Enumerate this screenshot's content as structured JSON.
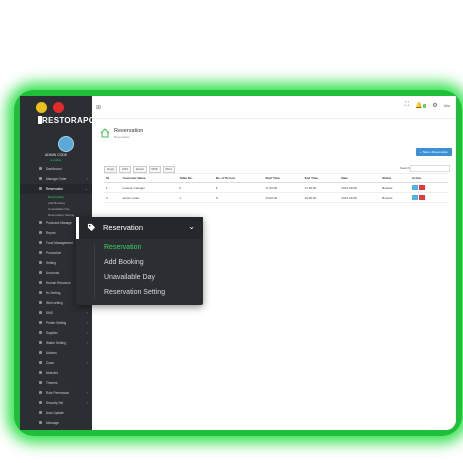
{
  "window": {
    "traffic_lights": [
      "#e8c21a",
      "#e42a2a",
      "#2bb642"
    ],
    "glow_color": "#1fbf3a"
  },
  "brand": {
    "name": "RESTORAPOS"
  },
  "user": {
    "name": "ADMIN CODE",
    "status": "● online"
  },
  "sidebar": {
    "items": [
      {
        "label": "Dashboard",
        "icon": "dashboard-icon"
      },
      {
        "label": "Manage Order",
        "icon": "cart-icon",
        "chevron": "›"
      },
      {
        "label": "Reservation",
        "icon": "tag-icon",
        "chevron": "⌄",
        "active": true
      },
      {
        "label": "Purchase Manage",
        "icon": "box-icon",
        "chevron": "›"
      },
      {
        "label": "Report",
        "icon": "chart-icon",
        "chevron": "›"
      },
      {
        "label": "Food Management",
        "icon": "food-icon",
        "chevron": "›"
      },
      {
        "label": "Production",
        "icon": "factory-icon",
        "chevron": "›"
      },
      {
        "label": "Setting",
        "icon": "gear-icon",
        "chevron": "›"
      },
      {
        "label": "Accounts",
        "icon": "wallet-icon",
        "chevron": "›"
      },
      {
        "label": "Human Resource",
        "icon": "people-icon",
        "chevron": "›"
      },
      {
        "label": "Hr-Setting",
        "icon": "sliders-icon",
        "chevron": "›"
      },
      {
        "label": "Web setting",
        "icon": "globe-icon",
        "chevron": "›"
      },
      {
        "label": "SMS",
        "icon": "sms-icon",
        "chevron": "›"
      },
      {
        "label": "Printer Setting",
        "icon": "printer-icon",
        "chevron": "›"
      },
      {
        "label": "Supplier",
        "icon": "truck-icon",
        "chevron": "›"
      },
      {
        "label": "Waiter Setting",
        "icon": "waiter-icon",
        "chevron": "›"
      },
      {
        "label": "Addons",
        "icon": "addons-icon"
      },
      {
        "label": "Zoom",
        "icon": "zoom-icon",
        "chevron": "›"
      },
      {
        "label": "Modules",
        "icon": "modules-icon"
      },
      {
        "label": "Themes",
        "icon": "themes-icon"
      },
      {
        "label": "Role Permission",
        "icon": "shield-icon",
        "chevron": "›"
      },
      {
        "label": "Security Set",
        "icon": "lock-icon",
        "chevron": "›"
      },
      {
        "label": "Auto Update",
        "icon": "refresh-icon"
      },
      {
        "label": "Message",
        "icon": "mail-icon"
      }
    ],
    "reservation_sub": [
      "Reservation",
      "Add Booking",
      "Unavailable Day",
      "Reservation Setting"
    ]
  },
  "page": {
    "title": "Reservation",
    "breadcrumb": "Reservation",
    "add_button": "+ Take a Reservation",
    "exports": [
      "Copy",
      "CSV",
      "Excel",
      "PDF",
      "Print"
    ],
    "search_label": "Search:",
    "table": {
      "headers": [
        "SL",
        "Customer Name",
        "Table No.",
        "No. of Person",
        "Start Time",
        "End Time",
        "Date",
        "Status",
        "Action"
      ],
      "rows": [
        [
          "1",
          "prateek mahajan",
          "5",
          "5",
          "17:00:00",
          "17:30:00",
          "2021-09-08",
          "Booked"
        ],
        [
          "2",
          "admin codex",
          "1",
          "9",
          "13:00:00",
          "23:00:00",
          "2021-09-08",
          "Booked"
        ]
      ]
    }
  },
  "popup": {
    "title": "Reservation",
    "chevron": "⌄",
    "items": [
      {
        "label": "Reservation",
        "active": true
      },
      {
        "label": "Add Booking"
      },
      {
        "label": "Unavailable Day"
      },
      {
        "label": "Reservation Setting"
      }
    ]
  },
  "topbar": {
    "grid_icon": "⊞",
    "fullscreen_icon": "⛶",
    "bell_icon": "🔔",
    "bell_count": "1",
    "settings_icon": "⚙",
    "user_label": "Uho"
  }
}
